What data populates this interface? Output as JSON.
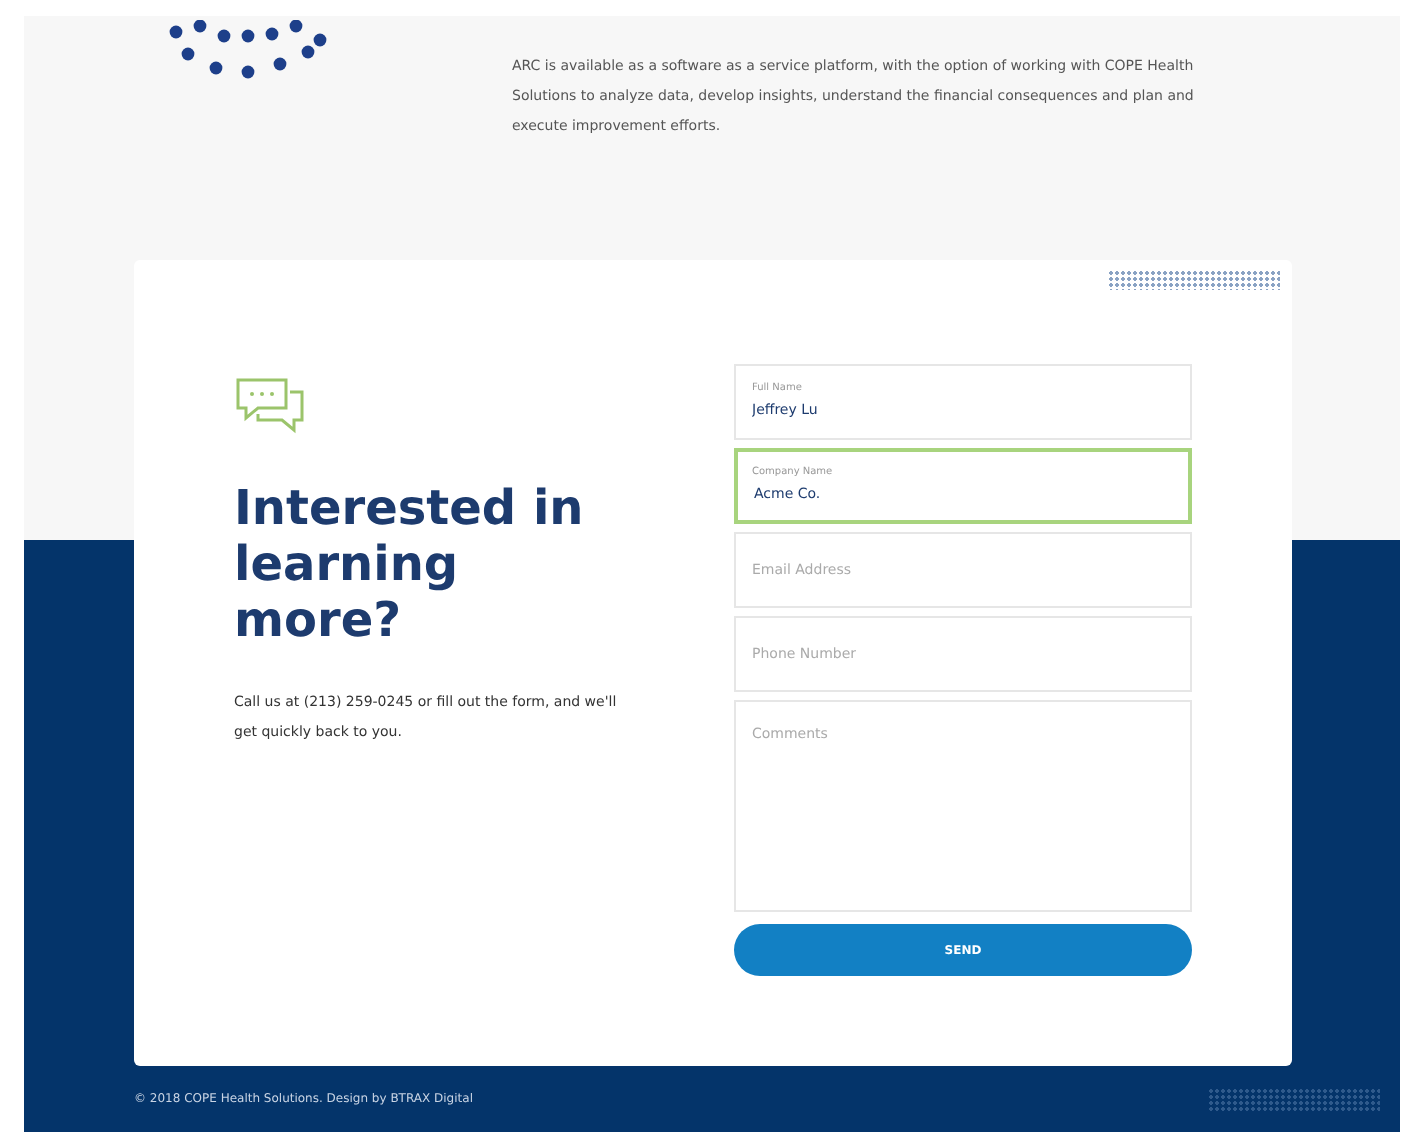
{
  "intro": {
    "text": "ARC is available as a software as a service platform, with the option of working with COPE Health Solutions to analyze data, develop insights, understand the financial consequences and plan and execute improvement efforts."
  },
  "contact": {
    "heading": "Interested in learning more?",
    "text": "Call us at (213) 259-0245 or fill out the form, and we'll get quickly back to you."
  },
  "form": {
    "fields": [
      {
        "label": "Full Name",
        "value": "Jeffrey Lu",
        "selected": false,
        "kind": "input"
      },
      {
        "label": "Company Name",
        "value": "Acme Co.",
        "selected": true,
        "kind": "input"
      },
      {
        "placeholder": "Email Address",
        "selected": false,
        "kind": "input"
      },
      {
        "placeholder": "Phone Number",
        "selected": false,
        "kind": "input"
      },
      {
        "placeholder": "Comments",
        "selected": false,
        "kind": "textarea"
      }
    ],
    "submit": "SEND"
  },
  "footer": {
    "text": "© 2018 COPE Health Solutions. Design by BTRAX Digital"
  }
}
